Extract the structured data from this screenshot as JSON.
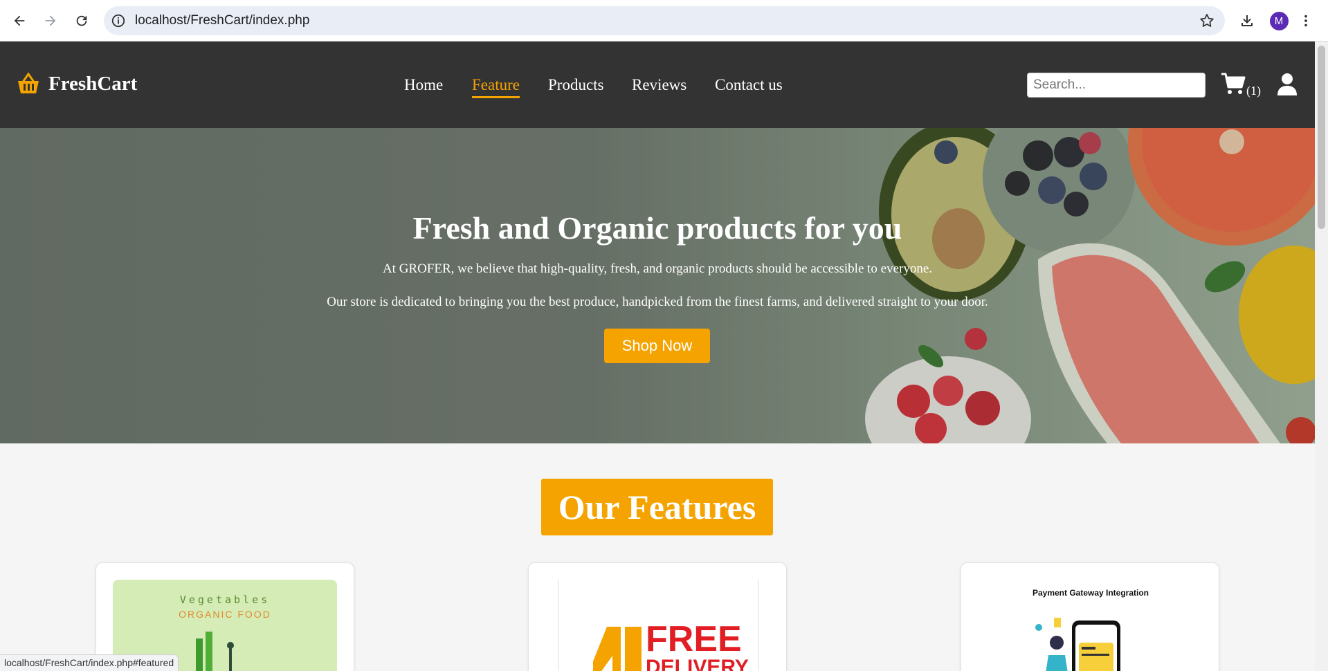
{
  "browser": {
    "url": "localhost/FreshCart/index.php",
    "status_url": "localhost/FreshCart/index.php#featured",
    "profile_initial": "M"
  },
  "site": {
    "brand": "FreshCart",
    "nav": [
      {
        "label": "Home",
        "active": false
      },
      {
        "label": "Feature",
        "active": true
      },
      {
        "label": "Products",
        "active": false
      },
      {
        "label": "Reviews",
        "active": false
      },
      {
        "label": "Contact us",
        "active": false
      }
    ],
    "search_placeholder": "Search...",
    "cart_count": "(1)"
  },
  "hero": {
    "title": "Fresh and Organic products for you",
    "line1": "At GROFER, we believe that high-quality, fresh, and organic products should be accessible to everyone.",
    "line2": "Our store is dedicated to bringing you the best produce, handpicked from the finest farms, and delivered straight to your door.",
    "cta": "Shop Now"
  },
  "features": {
    "heading": "Our Features",
    "cards": [
      {
        "image_title": "Vegetables",
        "image_subtitle": "ORGANIC FOOD"
      },
      {
        "image_title": "FREE",
        "image_subtitle": "DELIVERY"
      },
      {
        "image_title": "Payment Gateway Integration"
      }
    ]
  },
  "colors": {
    "accent": "#f5a300",
    "header_bg": "#333333",
    "delivery_red": "#e01e24"
  }
}
